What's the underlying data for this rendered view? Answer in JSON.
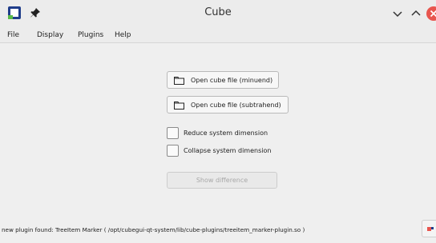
{
  "window": {
    "title": "Cube",
    "app_icon": "cube-app-icon",
    "controls": [
      "minimize-icon",
      "maximize-icon",
      "close-icon"
    ]
  },
  "menubar": {
    "items": [
      {
        "label": "File"
      },
      {
        "label": "Display"
      },
      {
        "label": "Plugins"
      },
      {
        "label": "Help"
      }
    ]
  },
  "main": {
    "open_minuend_label": "Open cube file (minuend)",
    "open_subtrahend_label": "Open cube file (subtrahend)",
    "reduce_label": "Reduce system dimension",
    "reduce_checked": false,
    "collapse_label": "Collapse system dimension",
    "collapse_checked": false,
    "show_difference_label": "Show difference",
    "show_difference_enabled": false
  },
  "status": {
    "message": "new plugin found: TreeItem Marker ( /opt/cubegui-qt-system/lib/cube-plugins/treeitem_marker-plugin.so )"
  },
  "colors": {
    "close_button": "#e8554e",
    "icon_blue": "#1f3d8a",
    "icon_green": "#58b947"
  }
}
